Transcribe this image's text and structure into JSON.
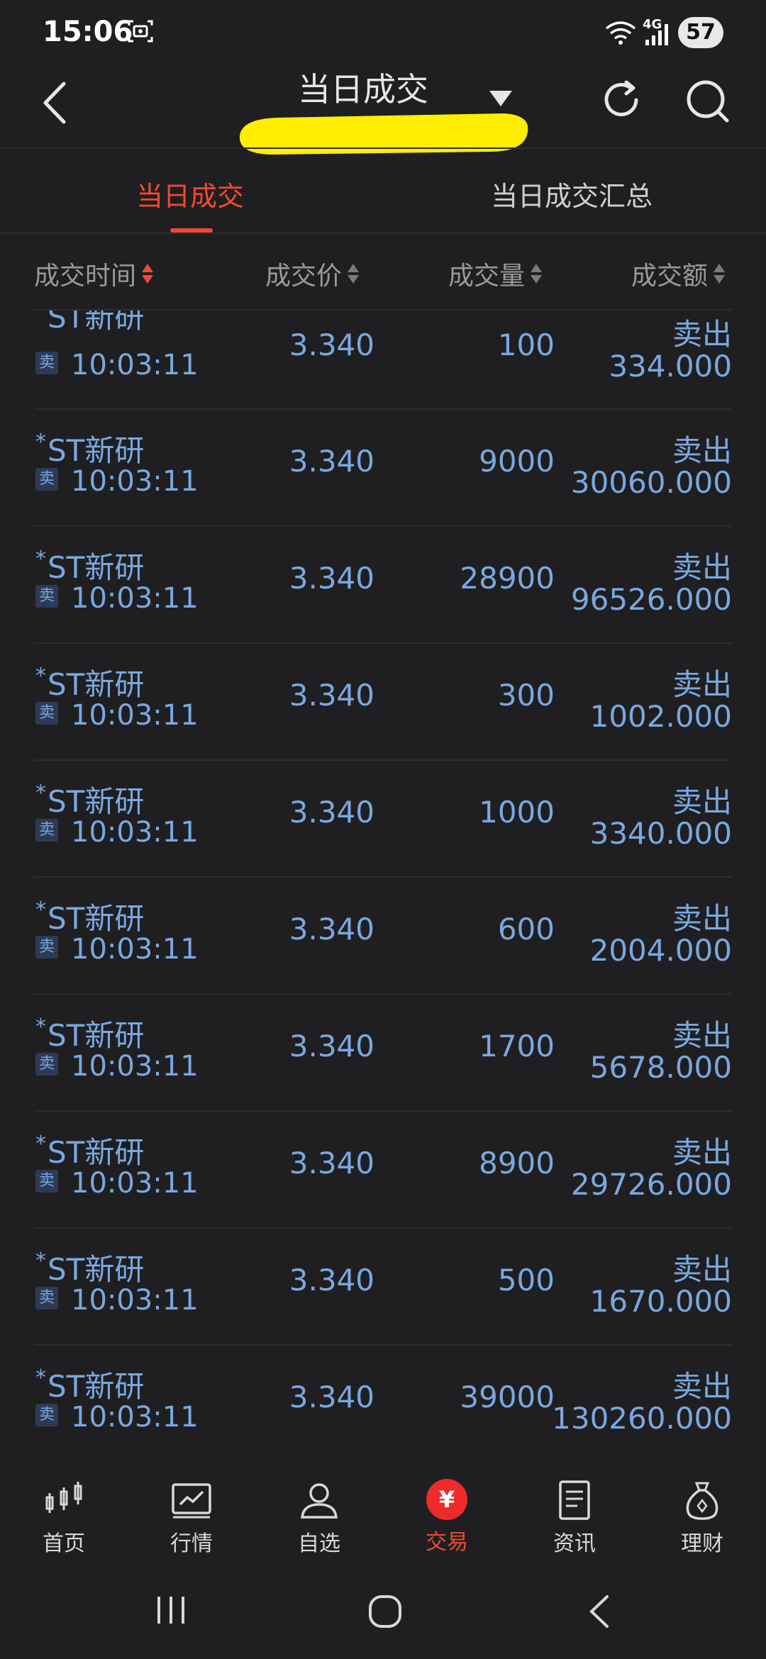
{
  "status_bar": {
    "time": "15:06",
    "network": "4G",
    "battery": "57"
  },
  "header": {
    "title": "当日成交"
  },
  "tabs": [
    {
      "label": "当日成交",
      "active": true
    },
    {
      "label": "当日成交汇总",
      "active": false
    }
  ],
  "columns": {
    "time": "成交时间",
    "price": "成交价",
    "volume": "成交量",
    "amount": "成交额"
  },
  "rows": [
    {
      "stock": "ST新研",
      "badge": "卖",
      "time": "10:03:11",
      "price": "3.340",
      "volume": "100",
      "side": "卖出",
      "amount": "334.000"
    },
    {
      "stock": "ST新研",
      "badge": "卖",
      "time": "10:03:11",
      "price": "3.340",
      "volume": "9000",
      "side": "卖出",
      "amount": "30060.000"
    },
    {
      "stock": "ST新研",
      "badge": "卖",
      "time": "10:03:11",
      "price": "3.340",
      "volume": "28900",
      "side": "卖出",
      "amount": "96526.000"
    },
    {
      "stock": "ST新研",
      "badge": "卖",
      "time": "10:03:11",
      "price": "3.340",
      "volume": "300",
      "side": "卖出",
      "amount": "1002.000"
    },
    {
      "stock": "ST新研",
      "badge": "卖",
      "time": "10:03:11",
      "price": "3.340",
      "volume": "1000",
      "side": "卖出",
      "amount": "3340.000"
    },
    {
      "stock": "ST新研",
      "badge": "卖",
      "time": "10:03:11",
      "price": "3.340",
      "volume": "600",
      "side": "卖出",
      "amount": "2004.000"
    },
    {
      "stock": "ST新研",
      "badge": "卖",
      "time": "10:03:11",
      "price": "3.340",
      "volume": "1700",
      "side": "卖出",
      "amount": "5678.000"
    },
    {
      "stock": "ST新研",
      "badge": "卖",
      "time": "10:03:11",
      "price": "3.340",
      "volume": "8900",
      "side": "卖出",
      "amount": "29726.000"
    },
    {
      "stock": "ST新研",
      "badge": "卖",
      "time": "10:03:11",
      "price": "3.340",
      "volume": "500",
      "side": "卖出",
      "amount": "1670.000"
    },
    {
      "stock": "ST新研",
      "badge": "卖",
      "time": "10:03:11",
      "price": "3.340",
      "volume": "39000",
      "side": "卖出",
      "amount": "130260.000"
    }
  ],
  "bottom_nav": [
    {
      "label": "首页",
      "icon": "candlestick-icon",
      "active": false
    },
    {
      "label": "行情",
      "icon": "market-chart-icon",
      "active": false
    },
    {
      "label": "自选",
      "icon": "user-icon",
      "active": false
    },
    {
      "label": "交易",
      "icon": "yuan-icon",
      "active": true,
      "symbol": "¥"
    },
    {
      "label": "资讯",
      "icon": "news-icon",
      "active": false
    },
    {
      "label": "理财",
      "icon": "money-bag-icon",
      "active": false
    }
  ],
  "colors": {
    "background": "#1f1f21",
    "accent": "#ee4a33",
    "value_blue": "#7aa8e0"
  }
}
